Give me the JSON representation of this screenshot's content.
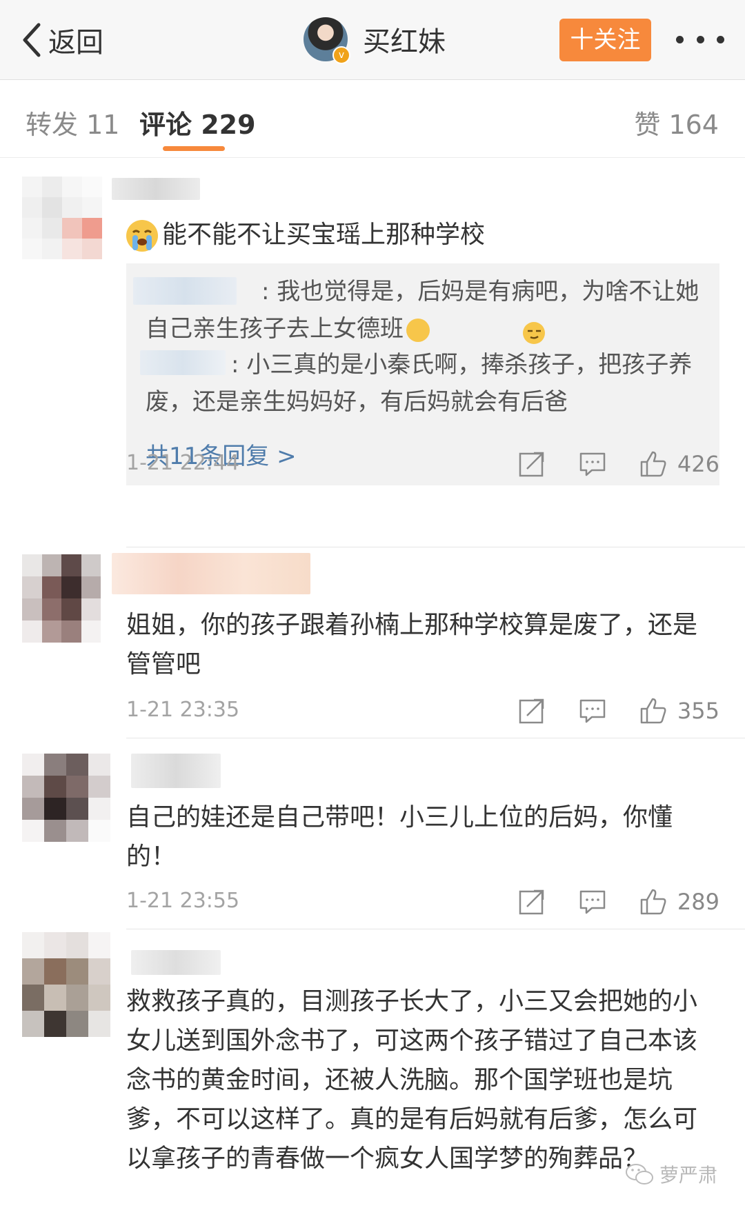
{
  "navbar": {
    "back_label": "返回",
    "username": "买红妹",
    "follow_label": "十关注"
  },
  "tabs": [
    {
      "label": "转发 11"
    },
    {
      "label": "评论 229"
    },
    {
      "label": "赞 164"
    }
  ],
  "comments": [
    {
      "text": "能不能不让买宝瑶上那种学校",
      "replies": [
        {
          "text": "我也觉得是，后妈是有病吧，为啥不让她自己亲生孩子去上女德班"
        },
        {
          "text": "小三真的是小秦氏啊，捧杀孩子，把孩子养废，还是亲生妈妈好，有后妈就会有后爸"
        }
      ],
      "more_replies": "共11条回复 >",
      "time": "1-21 22:44",
      "likes": "426"
    },
    {
      "text": "姐姐，你的孩子跟着孙楠上那种学校算是废了，还是管管吧",
      "time": "1-21 23:35",
      "likes": "355"
    },
    {
      "text": "自己的娃还是自己带吧！小三儿上位的后妈，你懂的！",
      "time": "1-21 23:55",
      "likes": "289"
    },
    {
      "text": "救救孩子真的，目测孩子长大了，小三又会把她的小女儿送到国外念书了，可这两个孩子错过了自己本该念书的黄金时间，还被人洗脑。那个国学班也是坑爹，不可以这样了。真的是有后妈就有后爹，怎么可以拿孩子的青春做一个疯女人国学梦的殉葬品？"
    }
  ],
  "watermark": "萝严肃",
  "colors": {
    "accent": "#f7893c",
    "link": "#4f7cab",
    "text": "#333333",
    "muted": "#a3a3a3"
  }
}
